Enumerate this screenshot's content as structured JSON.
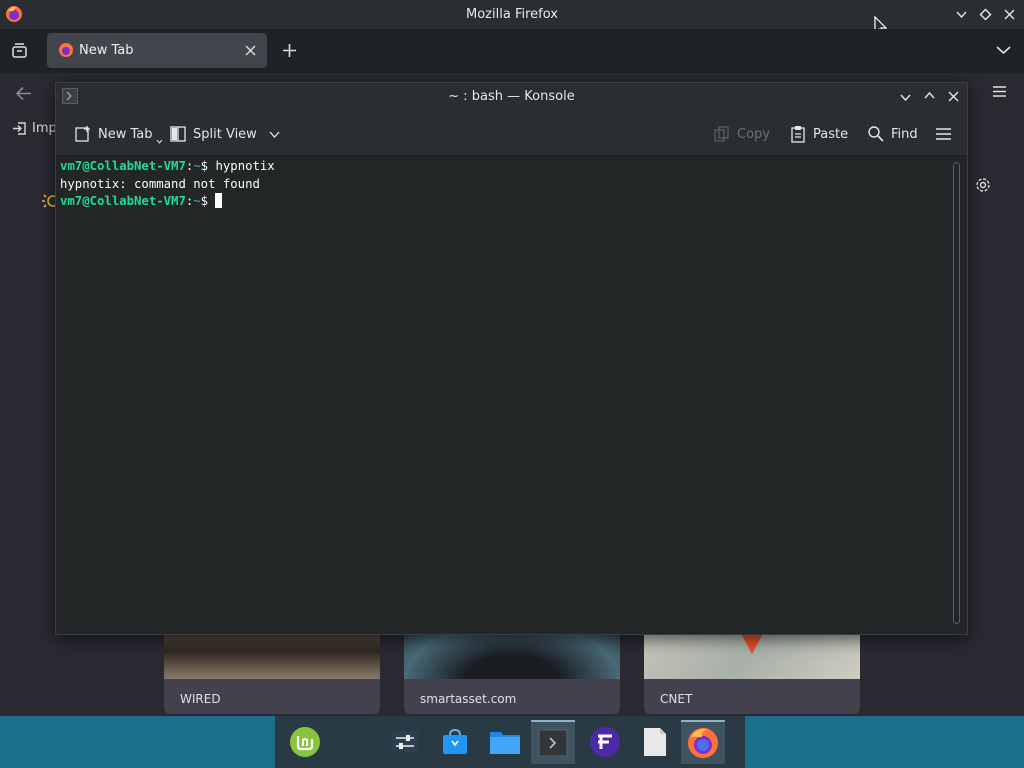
{
  "firefox": {
    "window_title": "Mozilla Firefox",
    "tab_label": "New Tab",
    "bookmarks_import_label": "Imp",
    "tiles": [
      {
        "label": "WIRED"
      },
      {
        "label": "smartasset.com"
      },
      {
        "label": "CNET"
      }
    ]
  },
  "konsole": {
    "window_title": "~ : bash — Konsole",
    "toolbar": {
      "new_tab": "New Tab",
      "split_view": "Split View",
      "copy": "Copy",
      "paste": "Paste",
      "find": "Find"
    },
    "terminal": {
      "prompt_user": "vm7@CollabNet-VM7",
      "prompt_sep": ":",
      "prompt_path": "~",
      "prompt_symbol": "$",
      "command": "hypnotix",
      "output": "hypnotix: command not found"
    }
  },
  "taskbar": {
    "items": [
      {
        "icon": "linux-mint-menu-icon"
      },
      {
        "icon": "system-settings-icon"
      },
      {
        "icon": "software-store-icon"
      },
      {
        "icon": "file-manager-icon"
      },
      {
        "icon": "konsole-terminal-icon"
      },
      {
        "icon": "app-launcher-icon"
      },
      {
        "icon": "text-editor-icon"
      },
      {
        "icon": "firefox-icon"
      }
    ]
  },
  "colors": {
    "prompt_user": "#1cdc9a",
    "prompt_path": "#3daee9",
    "taskbar": "#1b6f8a"
  }
}
